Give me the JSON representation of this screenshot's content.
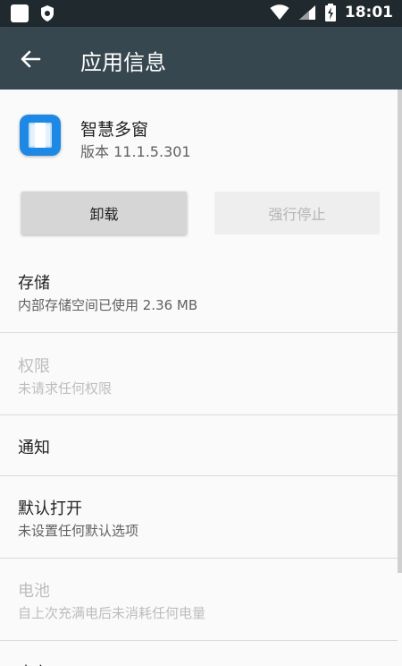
{
  "status_bar": {
    "time": "18:01"
  },
  "app_bar": {
    "title": "应用信息"
  },
  "app": {
    "name": "智慧多窗",
    "version": "版本 11.1.5.301"
  },
  "buttons": {
    "uninstall": "卸载",
    "force_stop": "强行停止"
  },
  "items": [
    {
      "title": "存储",
      "subtitle": "内部存储空间已使用 2.36 MB",
      "enabled": true
    },
    {
      "title": "权限",
      "subtitle": "未请求任何权限",
      "enabled": false
    },
    {
      "title": "通知",
      "subtitle": "",
      "enabled": true
    },
    {
      "title": "默认打开",
      "subtitle": "未设置任何默认选项",
      "enabled": true
    },
    {
      "title": "电池",
      "subtitle": "自上次充满电后未消耗任何电量",
      "enabled": false
    },
    {
      "title": "内存",
      "subtitle": "",
      "enabled": true
    }
  ],
  "colors": {
    "app_bar": "#37474f",
    "status_bar": "#1f292e",
    "background": "#fafafa",
    "app_icon": "#1e88e5"
  }
}
